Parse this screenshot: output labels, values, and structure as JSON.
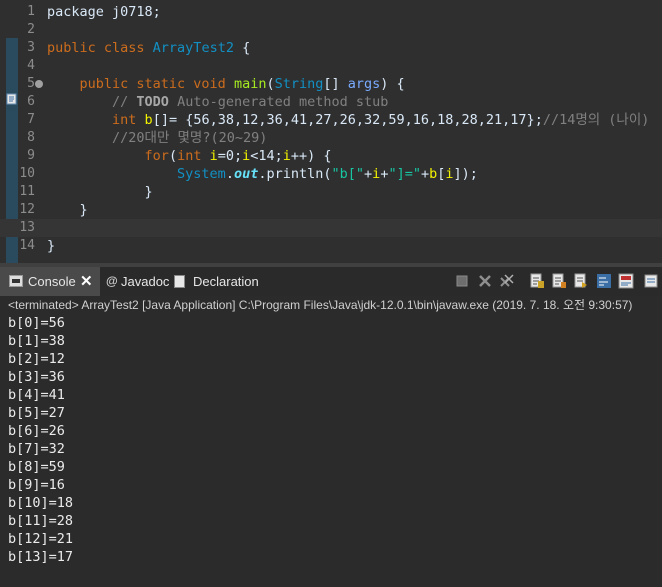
{
  "editor": {
    "lines": [
      {
        "n": "1",
        "parts": [
          {
            "t": "package j0718;",
            "c": ""
          }
        ]
      },
      {
        "n": "2",
        "parts": []
      },
      {
        "n": "3",
        "parts": [
          {
            "t": "public class ",
            "c": "kw"
          },
          {
            "t": "ArrayTest2",
            "c": "cls"
          },
          {
            "t": " {",
            "c": ""
          }
        ]
      },
      {
        "n": "4",
        "parts": []
      },
      {
        "n": "5",
        "parts": [
          {
            "t": "    ",
            "c": ""
          },
          {
            "t": "public static void ",
            "c": "kw"
          },
          {
            "t": "main",
            "c": "meth"
          },
          {
            "t": "(",
            "c": ""
          },
          {
            "t": "String",
            "c": "cls"
          },
          {
            "t": "[] ",
            "c": ""
          },
          {
            "t": "args",
            "c": "param"
          },
          {
            "t": ") {",
            "c": ""
          }
        ]
      },
      {
        "n": "6",
        "parts": [
          {
            "t": "        ",
            "c": ""
          },
          {
            "t": "// ",
            "c": "cm"
          },
          {
            "t": "TODO",
            "c": "todo"
          },
          {
            "t": " Auto-generated method stub",
            "c": "cm"
          }
        ]
      },
      {
        "n": "7",
        "parts": [
          {
            "t": "        ",
            "c": ""
          },
          {
            "t": "int ",
            "c": "kw"
          },
          {
            "t": "b",
            "c": "var"
          },
          {
            "t": "[]= {56,38,12,36,41,27,26,32,59,16,18,28,21,17};",
            "c": ""
          },
          {
            "t": "//14명의 (나이)",
            "c": "cm"
          }
        ]
      },
      {
        "n": "8",
        "parts": [
          {
            "t": "        ",
            "c": ""
          },
          {
            "t": "//20대만 몇명?(20~29)",
            "c": "cm"
          }
        ]
      },
      {
        "n": "9",
        "parts": [
          {
            "t": "            ",
            "c": ""
          },
          {
            "t": "for",
            "c": "kw"
          },
          {
            "t": "(",
            "c": ""
          },
          {
            "t": "int ",
            "c": "kw"
          },
          {
            "t": "i",
            "c": "var"
          },
          {
            "t": "=0;",
            "c": ""
          },
          {
            "t": "i",
            "c": "var"
          },
          {
            "t": "<14;",
            "c": ""
          },
          {
            "t": "i",
            "c": "var"
          },
          {
            "t": "++) {",
            "c": ""
          }
        ]
      },
      {
        "n": "10",
        "parts": [
          {
            "t": "                ",
            "c": ""
          },
          {
            "t": "System",
            "c": "cls"
          },
          {
            "t": ".",
            "c": ""
          },
          {
            "t": "out",
            "c": "fld"
          },
          {
            "t": ".println(",
            "c": ""
          },
          {
            "t": "\"b[\"",
            "c": "str"
          },
          {
            "t": "+",
            "c": ""
          },
          {
            "t": "i",
            "c": "var"
          },
          {
            "t": "+",
            "c": ""
          },
          {
            "t": "\"]=\"",
            "c": "str"
          },
          {
            "t": "+",
            "c": ""
          },
          {
            "t": "b",
            "c": "var"
          },
          {
            "t": "[",
            "c": ""
          },
          {
            "t": "i",
            "c": "var"
          },
          {
            "t": "]);",
            "c": ""
          }
        ]
      },
      {
        "n": "11",
        "parts": [
          {
            "t": "            }",
            "c": ""
          }
        ]
      },
      {
        "n": "12",
        "parts": [
          {
            "t": "    }",
            "c": ""
          }
        ]
      },
      {
        "n": "13",
        "parts": []
      },
      {
        "n": "14",
        "parts": [
          {
            "t": "}",
            "c": ""
          }
        ]
      }
    ]
  },
  "console": {
    "tabs": {
      "console": "Console",
      "javadoc": "Javadoc",
      "declaration": "Declaration",
      "javadoc_icon": "@"
    },
    "status": "<terminated> ArrayTest2 [Java Application] C:\\Program Files\\Java\\jdk-12.0.1\\bin\\javaw.exe (2019. 7. 18. 오전 9:30:57)",
    "output": [
      "b[0]=56",
      "b[1]=38",
      "b[2]=12",
      "b[3]=36",
      "b[4]=41",
      "b[5]=27",
      "b[6]=26",
      "b[7]=32",
      "b[8]=59",
      "b[9]=16",
      "b[10]=18",
      "b[11]=28",
      "b[12]=21",
      "b[13]=17"
    ],
    "toolbar_icons": [
      "terminate-icon",
      "remove-launch-icon",
      "remove-all-terminated-icon",
      "scroll-lock-icon",
      "show-console-on-output-icon",
      "show-console-on-error-icon",
      "word-wrap-icon",
      "pin-console-icon",
      "open-console-icon"
    ]
  },
  "colors": {
    "editor_bg": "#2f2f2f",
    "keyword": "#cc6c1d",
    "class": "#1290c3",
    "comment": "#808080",
    "string": "#17c6a3"
  }
}
